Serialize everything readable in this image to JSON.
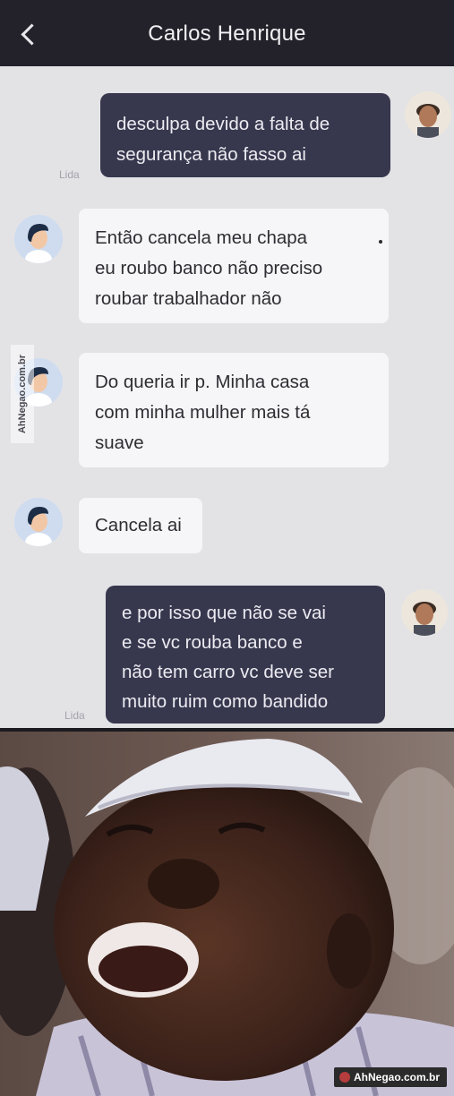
{
  "header": {
    "title": "Carlos Henrique"
  },
  "messages": [
    {
      "from": "me",
      "text_lines": [
        "desculpa devido a falta de",
        "segurança não fasso ai"
      ],
      "status": "Lida"
    },
    {
      "from": "other",
      "text_lines": [
        "Então cancela meu chapa",
        "eu roubo banco não preciso",
        "roubar trabalhador não"
      ]
    },
    {
      "from": "other",
      "text_lines": [
        "Do queria ir p. Minha casa",
        "com minha mulher mais tá",
        "suave"
      ]
    },
    {
      "from": "other",
      "text_lines": [
        "Cancela ai"
      ]
    },
    {
      "from": "me",
      "text_lines": [
        "e por isso que não se vai",
        "e se vc rouba banco e",
        "não tem carro vc deve ser",
        "muito ruim como bandido"
      ],
      "status": "Lida"
    }
  ],
  "watermark": {
    "side": "AhNegao.com.br",
    "badge": "AhNegao.com.br"
  },
  "icons": {
    "back": "chevron-left-icon",
    "default_avatar": "person-avatar-icon",
    "user_photo": "user-photo-avatar"
  },
  "colors": {
    "header_bg": "#23222a",
    "chat_bg": "#e3e3e6",
    "outgoing_bubble": "#37384e",
    "incoming_bubble": "#f6f6f8"
  }
}
